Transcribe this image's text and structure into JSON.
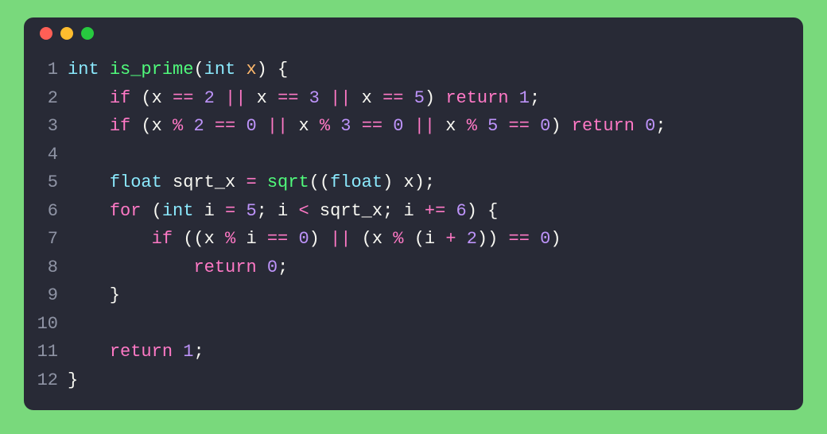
{
  "traffic_lights": [
    "red",
    "yellow",
    "green"
  ],
  "line_numbers": [
    "1",
    "2",
    "3",
    "4",
    "5",
    "6",
    "7",
    "8",
    "9",
    "10",
    "11",
    "12"
  ],
  "code_lines": [
    [
      {
        "t": "int",
        "c": "tk-type"
      },
      {
        "t": " ",
        "c": "tk-punct"
      },
      {
        "t": "is_prime",
        "c": "tk-fn"
      },
      {
        "t": "(",
        "c": "tk-punct"
      },
      {
        "t": "int",
        "c": "tk-type"
      },
      {
        "t": " ",
        "c": "tk-punct"
      },
      {
        "t": "x",
        "c": "tk-param"
      },
      {
        "t": ") {",
        "c": "tk-punct"
      }
    ],
    [
      {
        "t": "    ",
        "c": "tk-punct"
      },
      {
        "t": "if",
        "c": "tk-kw"
      },
      {
        "t": " (x ",
        "c": "tk-ident"
      },
      {
        "t": "==",
        "c": "tk-kw"
      },
      {
        "t": " ",
        "c": "tk-punct"
      },
      {
        "t": "2",
        "c": "tk-num"
      },
      {
        "t": " ",
        "c": "tk-punct"
      },
      {
        "t": "||",
        "c": "tk-kw"
      },
      {
        "t": " x ",
        "c": "tk-ident"
      },
      {
        "t": "==",
        "c": "tk-kw"
      },
      {
        "t": " ",
        "c": "tk-punct"
      },
      {
        "t": "3",
        "c": "tk-num"
      },
      {
        "t": " ",
        "c": "tk-punct"
      },
      {
        "t": "||",
        "c": "tk-kw"
      },
      {
        "t": " x ",
        "c": "tk-ident"
      },
      {
        "t": "==",
        "c": "tk-kw"
      },
      {
        "t": " ",
        "c": "tk-punct"
      },
      {
        "t": "5",
        "c": "tk-num"
      },
      {
        "t": ") ",
        "c": "tk-punct"
      },
      {
        "t": "return",
        "c": "tk-kw"
      },
      {
        "t": " ",
        "c": "tk-punct"
      },
      {
        "t": "1",
        "c": "tk-num"
      },
      {
        "t": ";",
        "c": "tk-punct"
      }
    ],
    [
      {
        "t": "    ",
        "c": "tk-punct"
      },
      {
        "t": "if",
        "c": "tk-kw"
      },
      {
        "t": " (x ",
        "c": "tk-ident"
      },
      {
        "t": "%",
        "c": "tk-kw"
      },
      {
        "t": " ",
        "c": "tk-punct"
      },
      {
        "t": "2",
        "c": "tk-num"
      },
      {
        "t": " ",
        "c": "tk-punct"
      },
      {
        "t": "==",
        "c": "tk-kw"
      },
      {
        "t": " ",
        "c": "tk-punct"
      },
      {
        "t": "0",
        "c": "tk-num"
      },
      {
        "t": " ",
        "c": "tk-punct"
      },
      {
        "t": "||",
        "c": "tk-kw"
      },
      {
        "t": " x ",
        "c": "tk-ident"
      },
      {
        "t": "%",
        "c": "tk-kw"
      },
      {
        "t": " ",
        "c": "tk-punct"
      },
      {
        "t": "3",
        "c": "tk-num"
      },
      {
        "t": " ",
        "c": "tk-punct"
      },
      {
        "t": "==",
        "c": "tk-kw"
      },
      {
        "t": " ",
        "c": "tk-punct"
      },
      {
        "t": "0",
        "c": "tk-num"
      },
      {
        "t": " ",
        "c": "tk-punct"
      },
      {
        "t": "||",
        "c": "tk-kw"
      },
      {
        "t": " x ",
        "c": "tk-ident"
      },
      {
        "t": "%",
        "c": "tk-kw"
      },
      {
        "t": " ",
        "c": "tk-punct"
      },
      {
        "t": "5",
        "c": "tk-num"
      },
      {
        "t": " ",
        "c": "tk-punct"
      },
      {
        "t": "==",
        "c": "tk-kw"
      },
      {
        "t": " ",
        "c": "tk-punct"
      },
      {
        "t": "0",
        "c": "tk-num"
      },
      {
        "t": ") ",
        "c": "tk-punct"
      },
      {
        "t": "return",
        "c": "tk-kw"
      },
      {
        "t": " ",
        "c": "tk-punct"
      },
      {
        "t": "0",
        "c": "tk-num"
      },
      {
        "t": ";",
        "c": "tk-punct"
      }
    ],
    [
      {
        "t": "",
        "c": "tk-punct"
      }
    ],
    [
      {
        "t": "    ",
        "c": "tk-punct"
      },
      {
        "t": "float",
        "c": "tk-type"
      },
      {
        "t": " sqrt_x ",
        "c": "tk-ident"
      },
      {
        "t": "=",
        "c": "tk-kw"
      },
      {
        "t": " ",
        "c": "tk-punct"
      },
      {
        "t": "sqrt",
        "c": "tk-fn"
      },
      {
        "t": "((",
        "c": "tk-punct"
      },
      {
        "t": "float",
        "c": "tk-type"
      },
      {
        "t": ") x);",
        "c": "tk-ident"
      }
    ],
    [
      {
        "t": "    ",
        "c": "tk-punct"
      },
      {
        "t": "for",
        "c": "tk-kw"
      },
      {
        "t": " (",
        "c": "tk-punct"
      },
      {
        "t": "int",
        "c": "tk-type"
      },
      {
        "t": " i ",
        "c": "tk-ident"
      },
      {
        "t": "=",
        "c": "tk-kw"
      },
      {
        "t": " ",
        "c": "tk-punct"
      },
      {
        "t": "5",
        "c": "tk-num"
      },
      {
        "t": "; i ",
        "c": "tk-ident"
      },
      {
        "t": "<",
        "c": "tk-kw"
      },
      {
        "t": " sqrt_x; i ",
        "c": "tk-ident"
      },
      {
        "t": "+=",
        "c": "tk-kw"
      },
      {
        "t": " ",
        "c": "tk-punct"
      },
      {
        "t": "6",
        "c": "tk-num"
      },
      {
        "t": ") {",
        "c": "tk-punct"
      }
    ],
    [
      {
        "t": "        ",
        "c": "tk-punct"
      },
      {
        "t": "if",
        "c": "tk-kw"
      },
      {
        "t": " ((x ",
        "c": "tk-ident"
      },
      {
        "t": "%",
        "c": "tk-kw"
      },
      {
        "t": " i ",
        "c": "tk-ident"
      },
      {
        "t": "==",
        "c": "tk-kw"
      },
      {
        "t": " ",
        "c": "tk-punct"
      },
      {
        "t": "0",
        "c": "tk-num"
      },
      {
        "t": ") ",
        "c": "tk-punct"
      },
      {
        "t": "||",
        "c": "tk-kw"
      },
      {
        "t": " (x ",
        "c": "tk-ident"
      },
      {
        "t": "%",
        "c": "tk-kw"
      },
      {
        "t": " (i ",
        "c": "tk-ident"
      },
      {
        "t": "+",
        "c": "tk-kw"
      },
      {
        "t": " ",
        "c": "tk-punct"
      },
      {
        "t": "2",
        "c": "tk-num"
      },
      {
        "t": ")) ",
        "c": "tk-punct"
      },
      {
        "t": "==",
        "c": "tk-kw"
      },
      {
        "t": " ",
        "c": "tk-punct"
      },
      {
        "t": "0",
        "c": "tk-num"
      },
      {
        "t": ")",
        "c": "tk-punct"
      }
    ],
    [
      {
        "t": "            ",
        "c": "tk-punct"
      },
      {
        "t": "return",
        "c": "tk-kw"
      },
      {
        "t": " ",
        "c": "tk-punct"
      },
      {
        "t": "0",
        "c": "tk-num"
      },
      {
        "t": ";",
        "c": "tk-punct"
      }
    ],
    [
      {
        "t": "    }",
        "c": "tk-punct"
      }
    ],
    [
      {
        "t": "",
        "c": "tk-punct"
      }
    ],
    [
      {
        "t": "    ",
        "c": "tk-punct"
      },
      {
        "t": "return",
        "c": "tk-kw"
      },
      {
        "t": " ",
        "c": "tk-punct"
      },
      {
        "t": "1",
        "c": "tk-num"
      },
      {
        "t": ";",
        "c": "tk-punct"
      }
    ],
    [
      {
        "t": "}",
        "c": "tk-punct"
      }
    ]
  ]
}
